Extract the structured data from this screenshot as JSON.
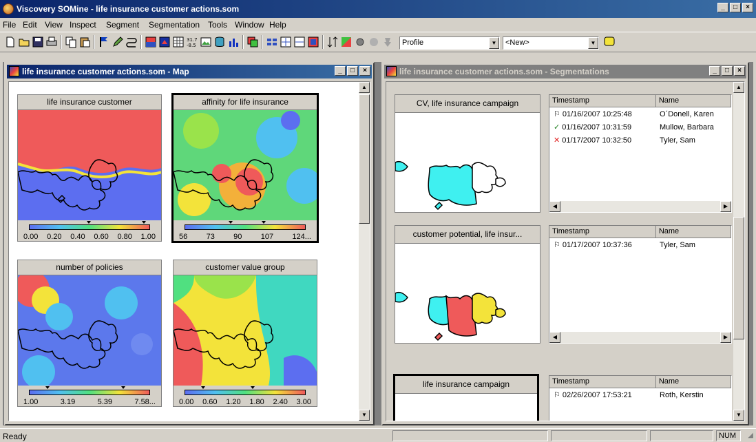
{
  "app": {
    "title": "Viscovery SOMine - life insurance customer actions.som"
  },
  "menu": [
    "File",
    "Edit",
    "View",
    "Inspect",
    "Segment",
    "Segmentation",
    "Tools",
    "Window",
    "Help"
  ],
  "toolbar": {
    "profile_combo": "Profile",
    "new_combo": "<New>"
  },
  "map_window": {
    "title": "life insurance customer actions.som - Map",
    "maps": [
      {
        "title": "life insurance customer",
        "ticks": [
          "0.00",
          "0.20",
          "0.40",
          "0.60",
          "0.80",
          "1.00"
        ]
      },
      {
        "title": "affinity for life insurance",
        "ticks": [
          "56",
          "73",
          "90",
          "107",
          "124..."
        ]
      },
      {
        "title": "number of policies",
        "ticks": [
          "1.00",
          "3.19",
          "5.39",
          "7.58..."
        ]
      },
      {
        "title": "customer value group",
        "ticks": [
          "0.00",
          "0.60",
          "1.20",
          "1.80",
          "2.40",
          "3.00"
        ]
      }
    ]
  },
  "seg_window": {
    "title": "life insurance customer actions.som - Segmentations",
    "segmentations": [
      {
        "title": "CV, life insurance campaign",
        "headers": [
          "Timestamp",
          "Name"
        ],
        "rows": [
          {
            "icon": "flag",
            "timestamp": "01/16/2007 10:25:48",
            "name": "O´Donell, Karen"
          },
          {
            "icon": "check",
            "timestamp": "01/16/2007 10:31:59",
            "name": "Mullow, Barbara"
          },
          {
            "icon": "cross",
            "timestamp": "01/17/2007 10:32:50",
            "name": "Tyler, Sam"
          }
        ]
      },
      {
        "title": "customer potential, life insur...",
        "headers": [
          "Timestamp",
          "Name"
        ],
        "rows": [
          {
            "icon": "flag",
            "timestamp": "01/17/2007 10:37:36",
            "name": "Tyler, Sam"
          }
        ]
      },
      {
        "title": "life insurance campaign",
        "headers": [
          "Timestamp",
          "Name"
        ],
        "rows": [
          {
            "icon": "flag",
            "timestamp": "02/26/2007 17:53:21",
            "name": "Roth, Kerstin"
          }
        ]
      }
    ]
  },
  "status": {
    "text": "Ready",
    "num": "NUM"
  },
  "colors": {
    "title_active": "#0a246a",
    "title_inactive": "#808080",
    "desktop": "#808080"
  }
}
